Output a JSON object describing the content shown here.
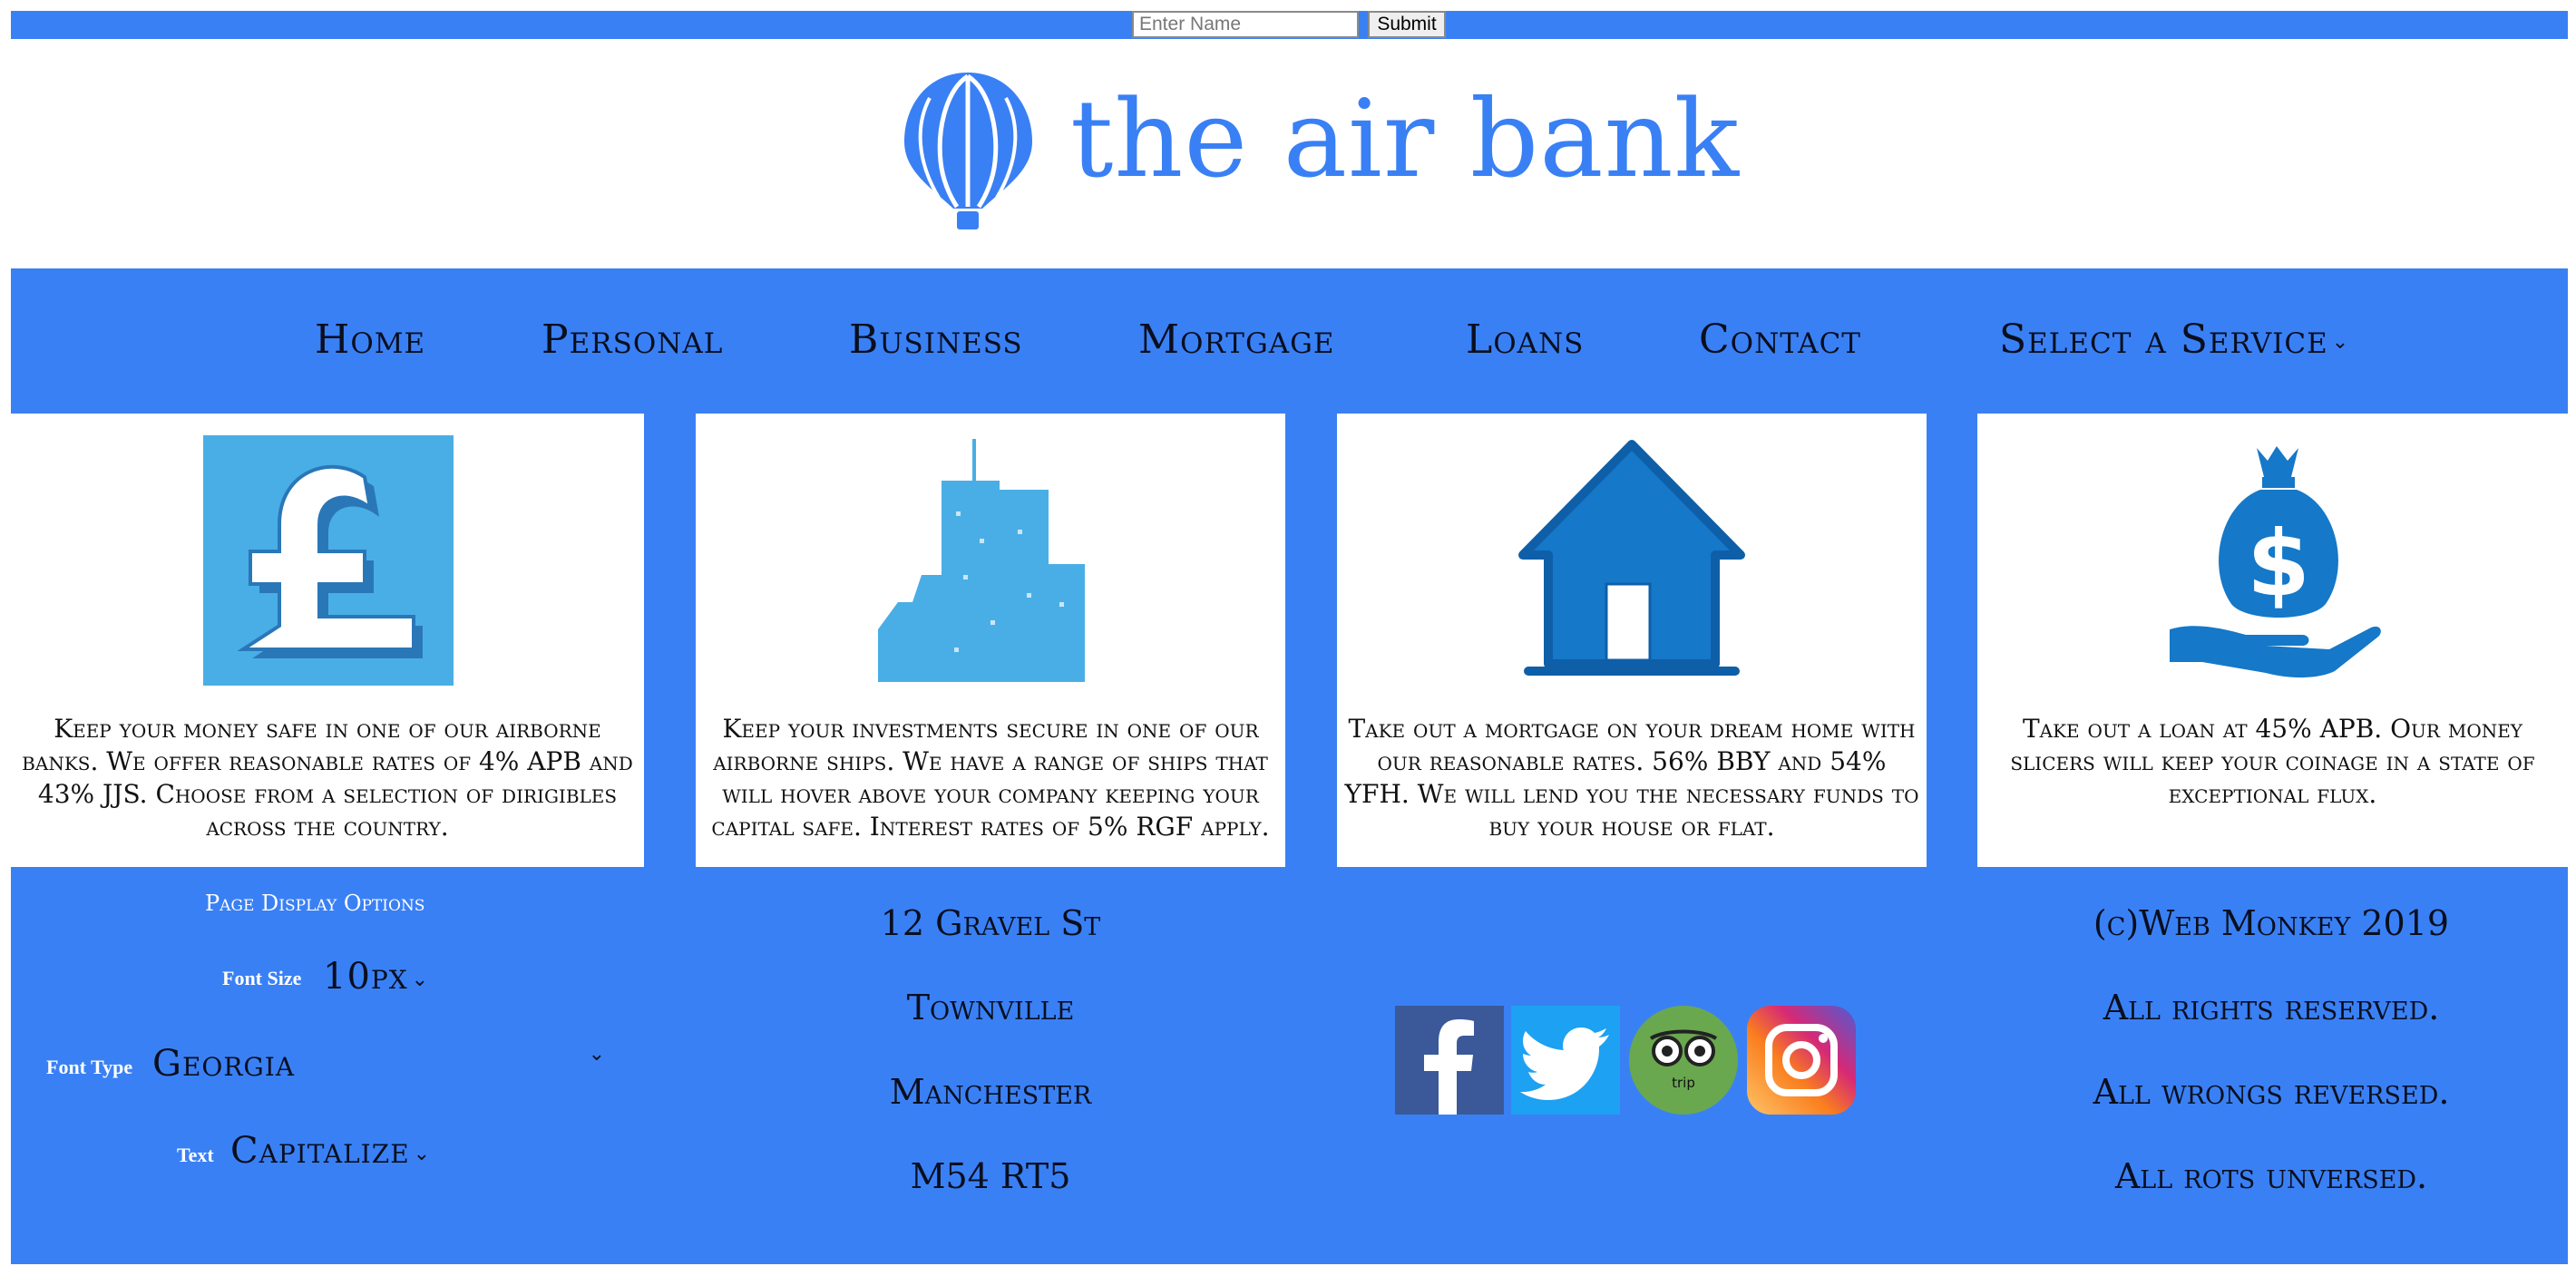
{
  "header": {
    "name_placeholder": "Enter Name",
    "submit_label": "Submit"
  },
  "logo": {
    "text": "the air bank",
    "icon": "hot-air-balloon-icon",
    "color": "#3a80f5"
  },
  "nav": {
    "items": [
      "Home",
      "Personal",
      "Business",
      "Mortgage",
      "Loans",
      "Contact"
    ],
    "service_select": "Select a Service"
  },
  "cards": [
    {
      "icon": "pound-sign-icon",
      "text": "Keep your money safe in one of our airborne banks. We offer reasonable rates of 4% APB and 43% JJS. Choose from a selection of dirigibles across the country."
    },
    {
      "icon": "skyscraper-icon",
      "text": "Keep your investments secure in one of our airborne ships. We have a range of ships that will hover above your company keeping your capital safe. Interest rates of 5% RGF apply."
    },
    {
      "icon": "house-icon",
      "text": "Take out a mortgage on your dream home with our reasonable rates. 56% BBY and 54% YFH. We will lend you the necessary funds to buy your house or flat."
    },
    {
      "icon": "money-bag-hand-icon",
      "text": "Take out a loan at 45% APB. Our money slicers will keep your coinage in a state of exceptional flux."
    }
  ],
  "options": {
    "title": "Page Display Options",
    "font_size_label": "Font Size",
    "font_size_value": "10px",
    "font_type_label": "Font Type",
    "font_type_value": "Georgia",
    "text_label": "Text",
    "text_value": "Capitalize"
  },
  "address": [
    "12 Gravel St",
    "Townville",
    "Manchester",
    "M54 RT5"
  ],
  "social": [
    "facebook-icon",
    "twitter-icon",
    "tripadvisor-icon",
    "instagram-icon"
  ],
  "legal": [
    "(c)Web Monkey 2019",
    "All rights reserved.",
    "All wrongs reversed.",
    "All rots unversed."
  ],
  "colors": {
    "brand_blue": "#3a80f5",
    "icon_blue": "#4aaee6",
    "dark_icon_blue": "#1578c8"
  }
}
